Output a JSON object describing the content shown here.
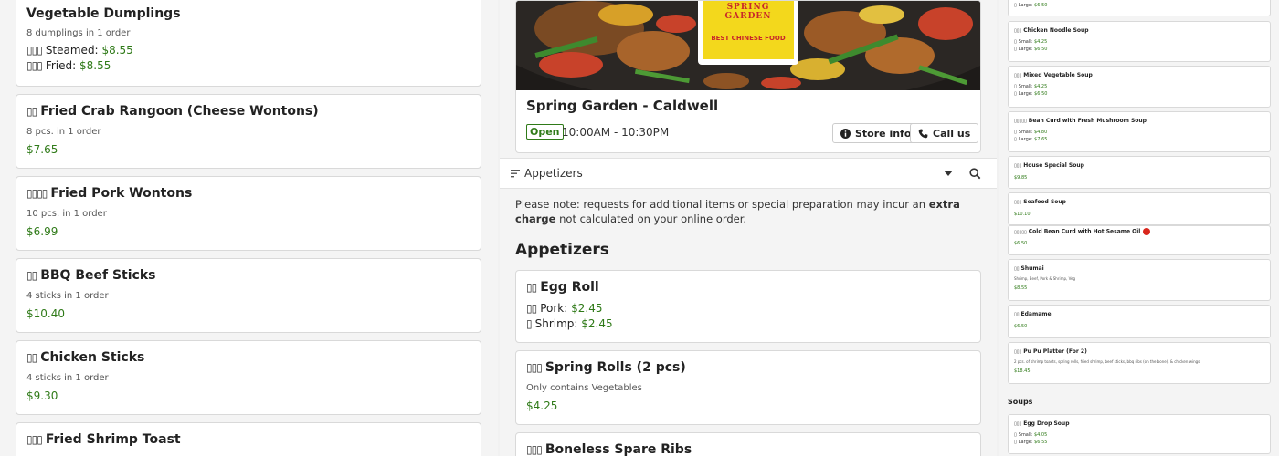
{
  "left": {
    "cards": [
      {
        "title": "Vegetable Dumplings",
        "sub": "8 dumplings in 1 order",
        "options": [
          {
            "glyph": "▯▯▯",
            "label": "Steamed:",
            "price": "$8.55"
          },
          {
            "glyph": "▯▯▯",
            "label": "Fried:",
            "price": "$8.55"
          }
        ]
      },
      {
        "glyph": "▯▯",
        "title": "Fried Crab Rangoon (Cheese Wontons)",
        "sub": "8 pcs. in 1 order",
        "price": "$7.65"
      },
      {
        "glyph": "▯▯▯▯",
        "title": "Fried Pork Wontons",
        "sub": "10 pcs. in 1 order",
        "price": "$6.99"
      },
      {
        "glyph": "▯▯",
        "title": "BBQ Beef Sticks",
        "sub": "4 sticks in 1 order",
        "price": "$10.40"
      },
      {
        "glyph": "▯▯",
        "title": "Chicken Sticks",
        "sub": "4 sticks in 1 order",
        "price": "$9.30"
      },
      {
        "glyph": "▯▯▯",
        "title": "Fried Shrimp Toast"
      }
    ]
  },
  "store": {
    "logo_line1": "SPRING GARDEN",
    "logo_line2": "BEST CHINESE FOOD",
    "name": "Spring Garden - Caldwell",
    "status": "Open",
    "hours": "10:00AM - 10:30PM",
    "store_info_label": "Store info",
    "call_label": "Call us"
  },
  "toolbar": {
    "category": "Appetizers"
  },
  "note": {
    "text_before": "Please note: requests for additional items or special preparation may incur an ",
    "bold": "extra charge",
    "text_after": " not calculated on your online order."
  },
  "menu": {
    "section_title": "Appetizers",
    "items": [
      {
        "glyph": "▯▯",
        "title": "Egg Roll",
        "options": [
          {
            "glyph": "▯▯",
            "label": "Pork:",
            "price": "$2.45"
          },
          {
            "glyph": "▯",
            "label": "Shrimp:",
            "price": "$2.45"
          }
        ]
      },
      {
        "glyph": "▯▯▯",
        "title": "Spring Rolls (2 pcs)",
        "sub": "Only contains Vegetables",
        "price": "$4.25"
      },
      {
        "glyph": "▯▯▯",
        "title": "Boneless Spare Ribs"
      }
    ]
  },
  "side": {
    "top_large": "Large:",
    "top_large_price": "$6.50",
    "items": [
      {
        "glyph": "▯▯▯",
        "title": "Chicken Noodle Soup",
        "small": "Small:",
        "small_price": "$4.25",
        "large": "Large:",
        "large_price": "$6.50"
      },
      {
        "glyph": "▯▯▯",
        "title": "Mixed Vegetable Soup",
        "small": "Small:",
        "small_price": "$4.25",
        "large": "Large:",
        "large_price": "$6.50"
      },
      {
        "glyph": "▯▯▯▯▯",
        "title": "Bean Curd with Fresh Mushroom Soup",
        "small": "Small:",
        "small_price": "$4.80",
        "large": "Large:",
        "large_price": "$7.65"
      },
      {
        "glyph": "▯▯▯",
        "title": "House Special Soup",
        "price": "$9.85"
      },
      {
        "glyph": "▯▯▯",
        "title": "Seafood Soup",
        "price": "$10.10"
      },
      {
        "glyph": "▯▯▯▯▯",
        "title": "Cold Bean Curd with Hot Sesame Oil",
        "price": "$6.50"
      },
      {
        "glyph": "▯▯",
        "title": "Shumai",
        "desc": "Shrimp, Beef, Pork & Shrimp, Veg",
        "price": "$8.55"
      },
      {
        "glyph": "▯▯",
        "title": "Edamame",
        "price": "$6.50"
      },
      {
        "glyph": "▯▯▯",
        "title": "Pu Pu Platter (For 2)",
        "desc": "2 pcs. of shrimp toasts, spring rolls, fried shrimp, beef sticks, bbq ribs (on the bone), & chicken wings",
        "price": "$18.45"
      }
    ],
    "soups_heading": "Soups",
    "egg_drop": {
      "glyph": "▯▯▯",
      "title": "Egg Drop Soup",
      "small": "Small:",
      "small_price": "$4.05",
      "large": "Large:",
      "large_price": "$6.55"
    }
  },
  "colors": {
    "price": "#2f7a18",
    "open": "#2f7a18",
    "logo_bg": "#f3d81c",
    "logo_text": "#c8272a"
  }
}
